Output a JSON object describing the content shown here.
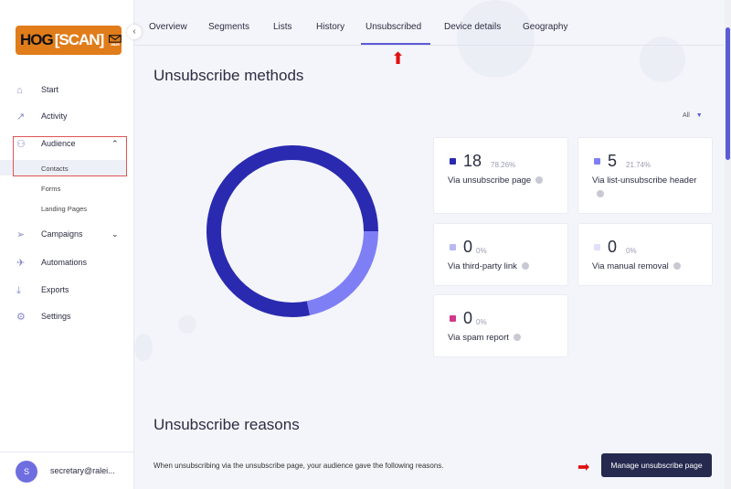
{
  "logo": {
    "text": "HOG[SCAN] MAILER"
  },
  "sidebar": {
    "items": [
      {
        "label": "Start",
        "icon": "home-icon"
      },
      {
        "label": "Activity",
        "icon": "chart-icon"
      },
      {
        "label": "Audience",
        "icon": "users-icon"
      },
      {
        "label": "Campaigns",
        "icon": "send-icon"
      },
      {
        "label": "Automations",
        "icon": "rocket-icon"
      },
      {
        "label": "Exports",
        "icon": "download-icon"
      },
      {
        "label": "Settings",
        "icon": "gear-icon"
      }
    ],
    "audience_sub": [
      "Contacts",
      "Forms",
      "Landing Pages"
    ],
    "user": {
      "initial": "S",
      "email": "secretary@ralei..."
    }
  },
  "tabs": [
    "Overview",
    "Segments",
    "Lists",
    "History",
    "Unsubscribed",
    "Device details",
    "Geography"
  ],
  "active_tab": "Unsubscribed",
  "methods": {
    "title": "Unsubscribe methods",
    "filter": "All",
    "items": [
      {
        "count": "18",
        "pct": "78.26%",
        "label": "Via unsubscribe page",
        "color": "#2a2ab0"
      },
      {
        "count": "5",
        "pct": "21.74%",
        "label": "Via list-unsubscribe header",
        "color": "#7f7ff5"
      },
      {
        "count": "0",
        "pct": "0%",
        "label": "Via third-party link",
        "color": "#b8b8f5"
      },
      {
        "count": "0",
        "pct": "0%",
        "label": "Via manual removal",
        "color": "#e0e0f8"
      },
      {
        "count": "0",
        "pct": "0%",
        "label": "Via spam report",
        "color": "#d0388a"
      }
    ]
  },
  "reasons": {
    "title": "Unsubscribe reasons",
    "description": "When unsubscribing via the unsubscribe page, your audience gave the following reasons.",
    "button": "Manage unsubscribe page"
  },
  "chart_data": {
    "type": "pie",
    "variant": "donut",
    "categories": [
      "Via unsubscribe page",
      "Via list-unsubscribe header",
      "Via third-party link",
      "Via manual removal",
      "Via spam report"
    ],
    "values": [
      18,
      5,
      0,
      0,
      0
    ],
    "colors": [
      "#2a2ab0",
      "#7f7ff5",
      "#b8b8f5",
      "#e0e0f8",
      "#d0388a"
    ]
  }
}
